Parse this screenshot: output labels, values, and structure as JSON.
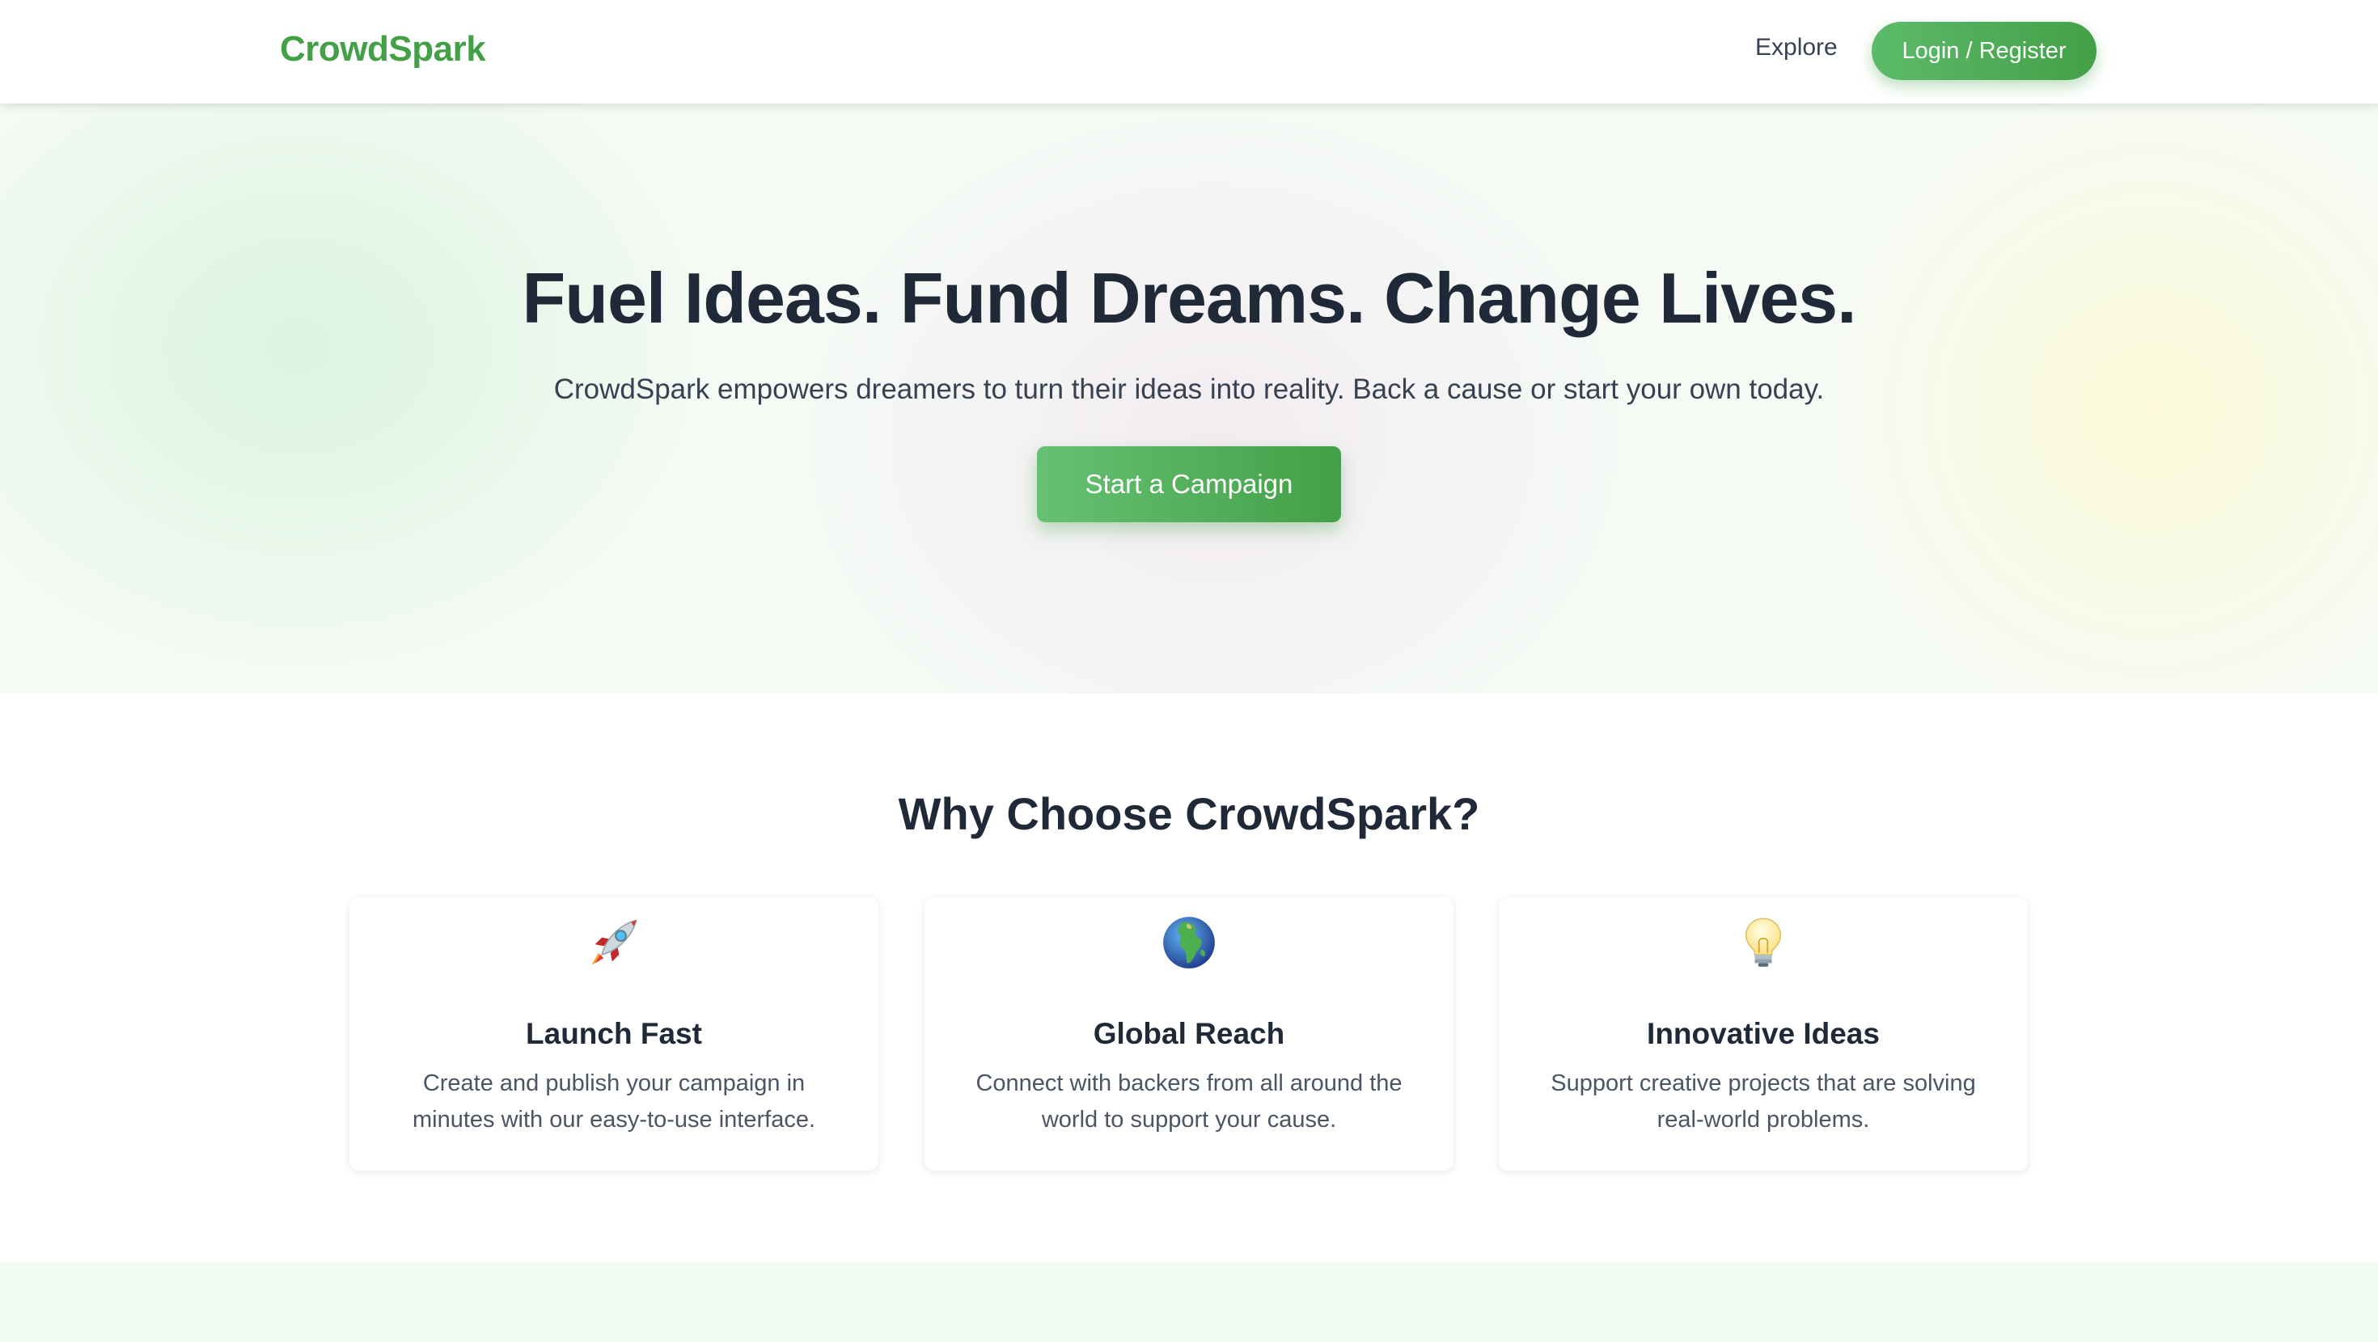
{
  "header": {
    "logo": "CrowdSpark",
    "nav": {
      "explore": "Explore",
      "login": "Login / Register"
    }
  },
  "hero": {
    "title": "Fuel Ideas. Fund Dreams. Change Lives.",
    "subtitle": "CrowdSpark empowers dreamers to turn their ideas into reality. Back a cause or start your own today.",
    "cta": "Start a Campaign"
  },
  "features": {
    "title": "Why Choose CrowdSpark?",
    "cards": [
      {
        "icon": "rocket-icon",
        "title": "Launch Fast",
        "text": "Create and publish your campaign in minutes with our easy-to-use interface."
      },
      {
        "icon": "globe-icon",
        "title": "Global Reach",
        "text": "Connect with backers from all around the world to support your cause."
      },
      {
        "icon": "lightbulb-icon",
        "title": "Innovative Ideas",
        "text": "Support creative projects that are solving real-world problems."
      }
    ]
  },
  "colors": {
    "brand": "#43a047",
    "heading": "#1f2937",
    "body_text": "#4b5563"
  }
}
